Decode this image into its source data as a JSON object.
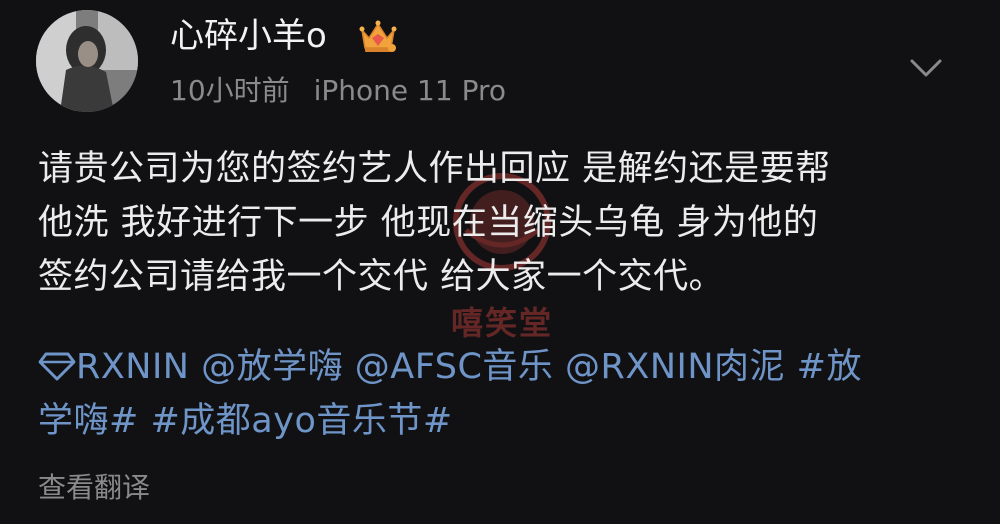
{
  "post": {
    "username": "心碎小羊o",
    "crown_icon": "crown-badge-icon",
    "time": "10小时前",
    "device": "iPhone 11 Pro",
    "more_icon": "chevron-down-icon",
    "content_lines": [
      "请贵公司为您的签约艺人作出回应 是解约还是要帮",
      "他洗 我好进行下一步 他现在当缩头乌龟 身为他的",
      "签约公司请给我一个交代 给大家一个交代。"
    ],
    "tags_line1": {
      "mention_rxnin": "RXNIN",
      "mention_fangxuehai": "@放学嗨",
      "mention_afsc": "@AFSC音乐",
      "mention_rxnin_rouni": "@RXNIN肉泥",
      "hashtag_start": "#放"
    },
    "tags_line2": {
      "hashtag_end": "学嗨#",
      "hashtag_chengdu": "#成都ayo音乐节#"
    },
    "translate_label": "查看翻译",
    "watermark_text": "嘻笑堂"
  },
  "colors": {
    "background": "#111114",
    "text": "#ececec",
    "link": "#6f95c8",
    "meta": "#8a8a8a"
  }
}
